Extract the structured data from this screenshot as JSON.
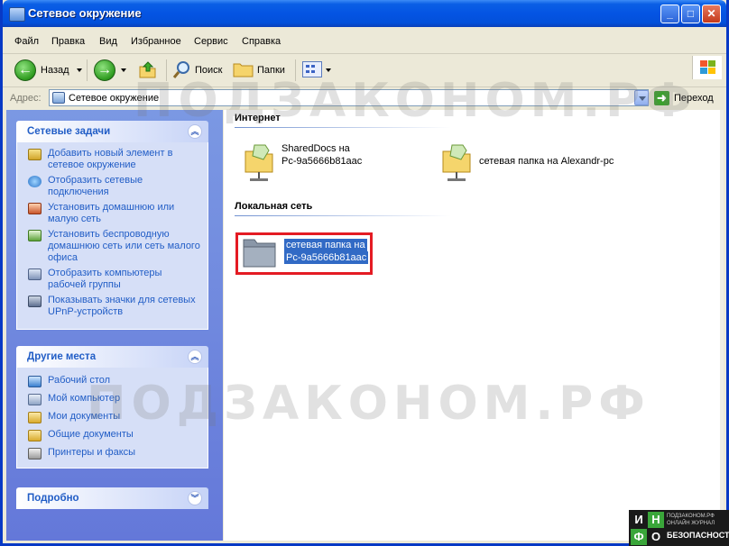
{
  "window": {
    "title": "Сетевое окружение"
  },
  "menu": [
    "Файл",
    "Правка",
    "Вид",
    "Избранное",
    "Сервис",
    "Справка"
  ],
  "toolbar": {
    "back": "Назад",
    "search": "Поиск",
    "folders": "Папки"
  },
  "address": {
    "label": "Адрес:",
    "value": "Сетевое окружение",
    "go": "Переход"
  },
  "panels": {
    "network_tasks": {
      "title": "Сетевые задачи",
      "items": [
        "Добавить новый элемент в сетевое окружение",
        "Отобразить сетевые подключения",
        "Установить домашнюю или малую сеть",
        "Установить беспроводную домашнюю сеть или сеть малого офиса",
        "Отобразить компьютеры рабочей группы",
        "Показывать значки для сетевых UPnP-устройств"
      ]
    },
    "other_places": {
      "title": "Другие места",
      "items": [
        "Рабочий стол",
        "Мой компьютер",
        "Мои документы",
        "Общие документы",
        "Принтеры и факсы"
      ]
    },
    "details": {
      "title": "Подробно"
    }
  },
  "groups": {
    "internet": {
      "title": "Интернет",
      "items": [
        {
          "line1": "SharedDocs на",
          "line2": "Pc-9a5666b81aac"
        },
        {
          "line1": "сетевая папка на Alexandr-pc",
          "line2": ""
        }
      ]
    },
    "local": {
      "title": "Локальная сеть",
      "items": [
        {
          "line1": "сетевая папка на",
          "line2": "Pc-9a5666b81aac"
        }
      ]
    }
  },
  "watermark": "ПОДЗАКОНОМ.РФ",
  "badge": {
    "letters": [
      "И",
      "Н",
      "Ф",
      "О"
    ],
    "line1": "ПОДЗАКОНОМ.РФ",
    "line2": "ОНЛАЙН ЖУРНАЛ",
    "line3": "БЕЗОПАСНОСТЬ"
  }
}
